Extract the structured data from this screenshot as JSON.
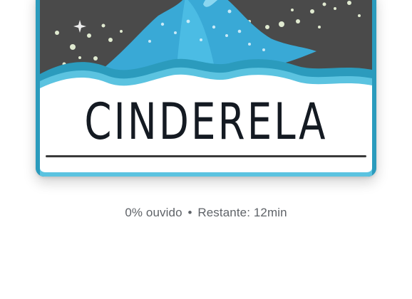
{
  "book": {
    "title": "CINDERELA",
    "progress_fraction": 0.0
  },
  "status": {
    "heard": "0% ouvido",
    "separator": "•",
    "remaining": "Restante: 12min"
  },
  "colors": {
    "border_teal": "#2b9bbd",
    "sky": "#4a4a4a",
    "mountain": "#39a9d6",
    "card": "#ffffff",
    "title_ink": "#141a22",
    "status_text": "#5f6368"
  },
  "icons": {
    "cover_art": "cinderella-castle-illustration"
  }
}
